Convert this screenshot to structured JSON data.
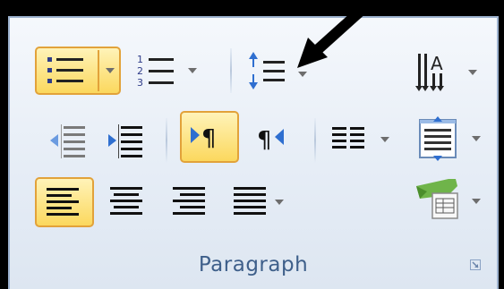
{
  "group": {
    "label": "Paragraph"
  },
  "icons": {
    "bullets": "bullets-icon",
    "numbering": "numbering-icon",
    "sort": "sort-icon",
    "text_direction": "text-direction-icon",
    "decrease_indent": "decrease-indent-icon",
    "increase_indent": "increase-indent-icon",
    "ltr": "left-to-right-icon",
    "rtl": "right-to-left-icon",
    "columns": "columns-icon",
    "spacing": "line-spacing-icon",
    "align_left": "align-left-icon",
    "center": "center-icon",
    "align_right": "align-right-icon",
    "justify": "justify-icon",
    "shading": "shading-icon",
    "launcher": "dialog-launcher-icon",
    "pointer": "arrow-pointer-icon"
  },
  "colors": {
    "highlight": "#fbd85e",
    "highlight_border": "#e2a23a",
    "label": "#3e5f8a",
    "panel": "#e6edf6"
  },
  "state": {
    "bullets_active": true,
    "ltr_active": true,
    "align_left_active": true
  }
}
